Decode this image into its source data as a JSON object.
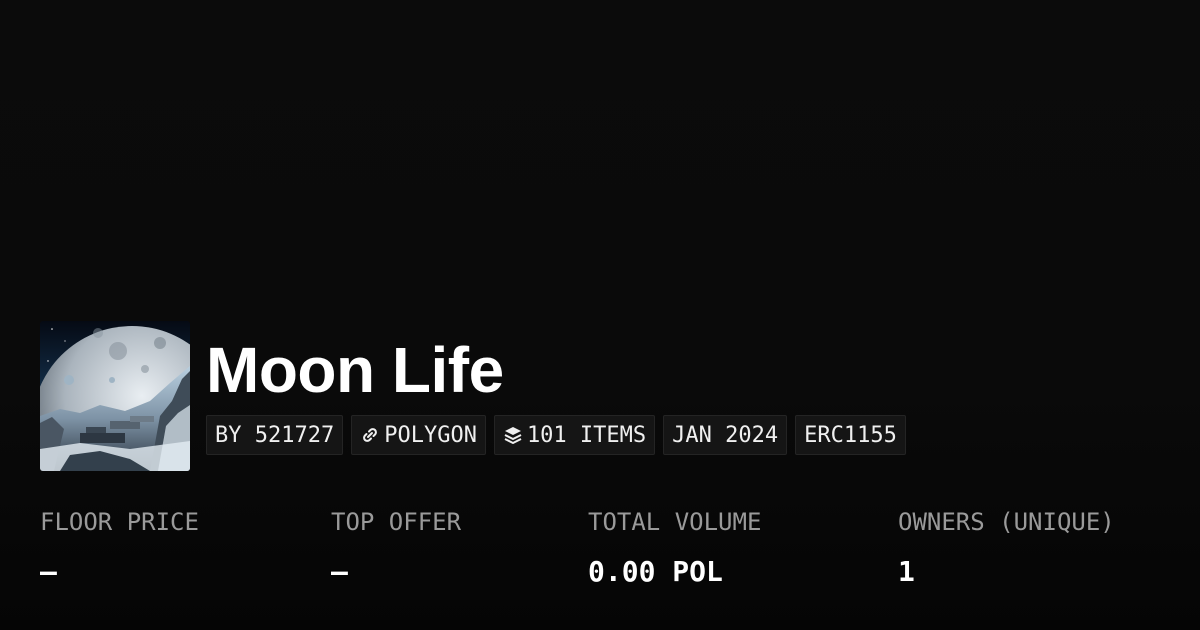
{
  "collection": {
    "title": "Moon Life",
    "chips": {
      "creator": "BY 521727",
      "chain": "POLYGON",
      "items": "101 ITEMS",
      "date": "JAN 2024",
      "standard": "ERC1155"
    },
    "icons": {
      "chain": "link-icon",
      "items": "layers-icon"
    }
  },
  "stats": [
    {
      "label": "FLOOR PRICE",
      "value": "—"
    },
    {
      "label": "TOP OFFER",
      "value": "—"
    },
    {
      "label": "TOTAL VOLUME",
      "value": "0.00 POL"
    },
    {
      "label": "OWNERS (UNIQUE)",
      "value": "1"
    }
  ],
  "colors": {
    "background": "#0a0a0a",
    "chip_background": "#151515",
    "label": "#9a9a9a",
    "text": "#ffffff"
  }
}
